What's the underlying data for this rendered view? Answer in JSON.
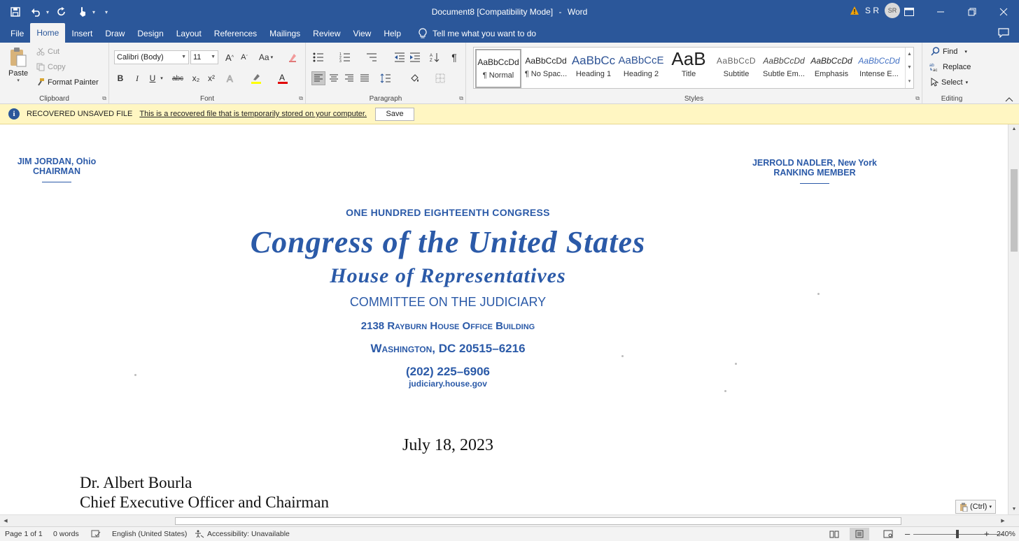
{
  "app": {
    "window_title": "Document8 [Compatibility Mode]",
    "app_name": "Word",
    "title_separator": "-",
    "user_initials": "S R",
    "avatar_initials": "SR"
  },
  "tabs": [
    "File",
    "Home",
    "Insert",
    "Draw",
    "Design",
    "Layout",
    "References",
    "Mailings",
    "Review",
    "View",
    "Help"
  ],
  "active_tab": "Home",
  "tell_me": "Tell me what you want to do",
  "ribbon": {
    "clipboard": {
      "label": "Clipboard",
      "paste": "Paste",
      "cut": "Cut",
      "copy": "Copy",
      "format_painter": "Format Painter"
    },
    "font": {
      "label": "Font",
      "name": "Calibri (Body)",
      "size": "11",
      "grow": "A",
      "shrink": "A",
      "case": "Aa",
      "bold": "B",
      "italic": "I",
      "underline": "U",
      "strike": "abc",
      "sub": "x₂",
      "sup": "x²"
    },
    "paragraph": {
      "label": "Paragraph"
    },
    "styles": {
      "label": "Styles",
      "items": [
        {
          "preview": "AaBbCcDd",
          "name": "¶ Normal"
        },
        {
          "preview": "AaBbCcDd",
          "name": "¶ No Spac..."
        },
        {
          "preview": "AaBbCc",
          "name": "Heading 1"
        },
        {
          "preview": "AaBbCcE",
          "name": "Heading 2"
        },
        {
          "preview": "AaB",
          "name": "Title"
        },
        {
          "preview": "AaBbCcD",
          "name": "Subtitle"
        },
        {
          "preview": "AaBbCcDd",
          "name": "Subtle Em..."
        },
        {
          "preview": "AaBbCcDd",
          "name": "Emphasis"
        },
        {
          "preview": "AaBbCcDd",
          "name": "Intense E..."
        }
      ]
    },
    "editing": {
      "label": "Editing",
      "find": "Find",
      "replace": "Replace",
      "select": "Select"
    }
  },
  "message_bar": {
    "title": "RECOVERED UNSAVED FILE",
    "text": "This is a recovered file that is temporarily stored on your computer.",
    "button": "Save"
  },
  "document": {
    "left_header": [
      "JIM JORDAN, Ohio",
      "CHAIRMAN"
    ],
    "right_header": [
      "JERROLD NADLER, New York",
      "RANKING MEMBER"
    ],
    "congress_number": "ONE HUNDRED EIGHTEENTH CONGRESS",
    "congress_title": "Congress of the United States",
    "house": "House of Representatives",
    "committee": "COMMITTEE ON THE JUDICIARY",
    "building": "2138 Rayburn House Office Building",
    "city": "Washington, DC 20515–6216",
    "phone": "(202) 225–6906",
    "website": "judiciary.house.gov",
    "date": "July 18, 2023",
    "recipient_name": "Dr. Albert Bourla",
    "recipient_title": "Chief Executive Officer and Chairman"
  },
  "paste_options": "(Ctrl)",
  "status": {
    "page": "Page 1 of 1",
    "words": "0 words",
    "language": "English (United States)",
    "accessibility": "Accessibility: Unavailable",
    "zoom": "240%",
    "zoom_minus": "–",
    "zoom_plus": "+"
  },
  "colors": {
    "brand": "#2b579a",
    "letterhead": "#2b5aa8",
    "message_bar": "#fff6c2"
  }
}
